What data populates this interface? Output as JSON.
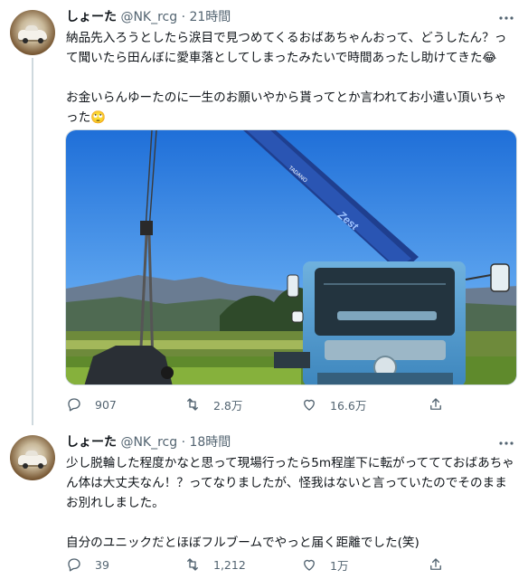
{
  "tweets": [
    {
      "name": "しょーた",
      "handle": "@NK_rcg",
      "time": "· 21時間",
      "paragraphs": [
        "納品先入ろうとしたら涙目で見つめてくるおばあちゃんおって、どうしたん？って聞いたら田んぼに愛車落としてしまったみたいで時間あったし助けてきた😂",
        "お金いらんゆーたのに一生のお願いやから貰ってとか言われてお小遣い頂いちゃった🙄"
      ],
      "image": {
        "crane_lettering": "Zest",
        "crane_brand": "TADANO"
      },
      "actions": {
        "replies": "907",
        "retweets": "2.8万",
        "likes": "16.6万"
      }
    },
    {
      "name": "しょーた",
      "handle": "@NK_rcg",
      "time": "· 18時間",
      "paragraphs": [
        "少し脱輪した程度かなと思って現場行ったら5m程崖下に転がっててておばあちゃん体は大丈夫なん！？ってなりましたが、怪我はないと言っていたのでそのままお別れしました。",
        "自分のユニックだとほぼフルブームでやっと届く距離でした(笑)"
      ],
      "actions": {
        "replies": "39",
        "retweets": "1,212",
        "likes": "1万"
      }
    }
  ],
  "icons": [
    "more-icon",
    "reply-icon",
    "retweet-icon",
    "like-icon",
    "share-icon"
  ],
  "colors": {
    "text": "#0f1419",
    "secondary": "#536471",
    "divider": "#cfd9de",
    "sky": "#3f8fe6",
    "truck": "#4a93c7",
    "boom": "#1f3f8f"
  }
}
